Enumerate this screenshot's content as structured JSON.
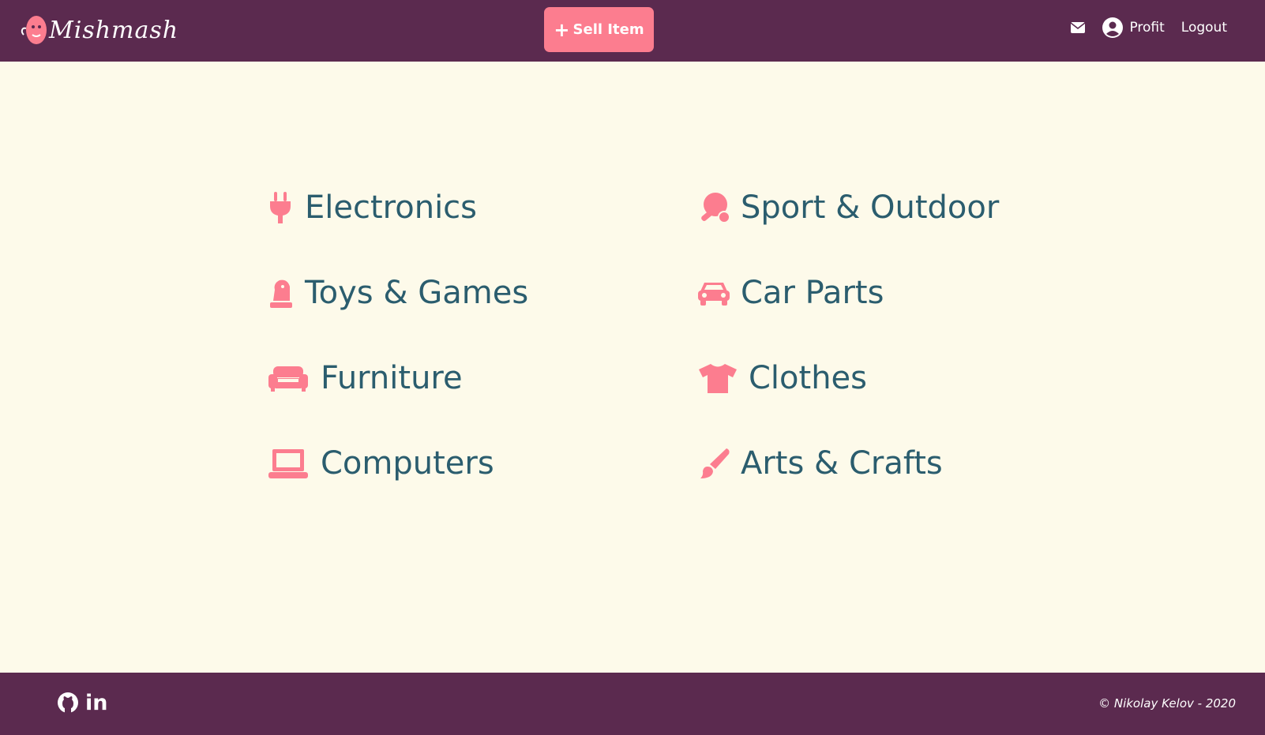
{
  "header": {
    "logo_text": "Mishmash",
    "sell_button_label": "Sell Item",
    "profile_label": "Profit",
    "logout_label": "Logout"
  },
  "categories": [
    {
      "label": "Electronics",
      "icon": "plug-icon"
    },
    {
      "label": "Sport & Outdoor",
      "icon": "table-tennis-icon"
    },
    {
      "label": "Toys & Games",
      "icon": "chess-knight-icon"
    },
    {
      "label": "Car Parts",
      "icon": "car-icon"
    },
    {
      "label": "Furniture",
      "icon": "couch-icon"
    },
    {
      "label": "Clothes",
      "icon": "tshirt-icon"
    },
    {
      "label": "Computers",
      "icon": "laptop-icon"
    },
    {
      "label": "Arts & Crafts",
      "icon": "paint-brush-icon"
    }
  ],
  "footer": {
    "copyright": "© Nikolay Kelov - 2020",
    "linkedin_label": "in"
  },
  "colors": {
    "nav_bg": "#5b2a4f",
    "accent": "#fc7d8f",
    "page_bg": "#fdfaea",
    "category_text": "#2b5d6e"
  }
}
